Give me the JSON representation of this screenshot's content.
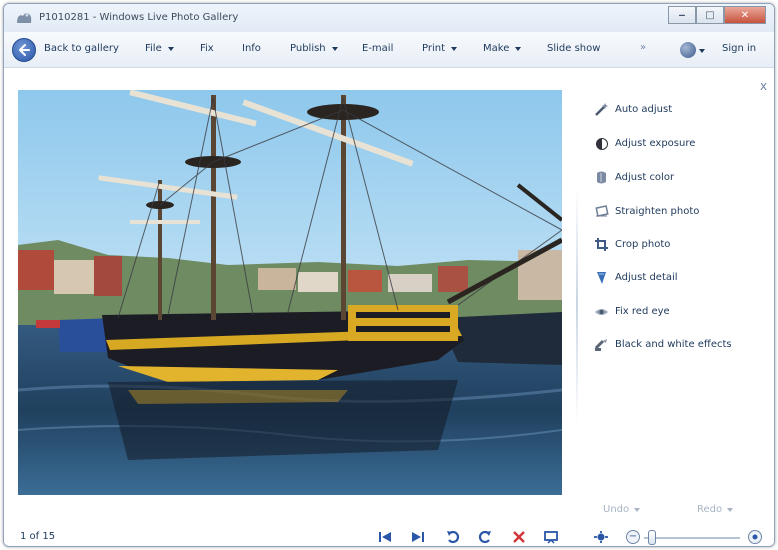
{
  "window": {
    "title": "P1010281 - Windows Live Photo Gallery",
    "controls": {
      "minimize": "‒",
      "maximize": "□",
      "close": "✕"
    }
  },
  "toolbar": {
    "back_label": "Back to gallery",
    "items": [
      {
        "label": "File",
        "dropdown": true
      },
      {
        "label": "Fix",
        "dropdown": false
      },
      {
        "label": "Info",
        "dropdown": false
      },
      {
        "label": "Publish",
        "dropdown": true
      },
      {
        "label": "E-mail",
        "dropdown": false
      },
      {
        "label": "Print",
        "dropdown": true
      },
      {
        "label": "Make",
        "dropdown": true
      },
      {
        "label": "Slide show",
        "dropdown": false
      }
    ],
    "overflow_label": "»",
    "sign_in_label": "Sign in"
  },
  "fix_pane": {
    "close_label": "x",
    "items": [
      {
        "label": "Auto adjust",
        "icon": "magic-wand-icon"
      },
      {
        "label": "Adjust exposure",
        "icon": "exposure-icon"
      },
      {
        "label": "Adjust color",
        "icon": "color-icon"
      },
      {
        "label": "Straighten photo",
        "icon": "straighten-icon"
      },
      {
        "label": "Crop photo",
        "icon": "crop-icon"
      },
      {
        "label": "Adjust detail",
        "icon": "detail-icon"
      },
      {
        "label": "Fix red eye",
        "icon": "red-eye-icon"
      },
      {
        "label": "Black and white effects",
        "icon": "black-white-icon"
      }
    ],
    "undo_label": "Undo",
    "redo_label": "Redo"
  },
  "status": {
    "counter": "1 of 15",
    "zoom_fraction": 0.05
  },
  "colors": {
    "accent": "#2a56a8",
    "text": "#1e395b",
    "disabled": "#a8b4c4",
    "delete": "#d1363a"
  }
}
